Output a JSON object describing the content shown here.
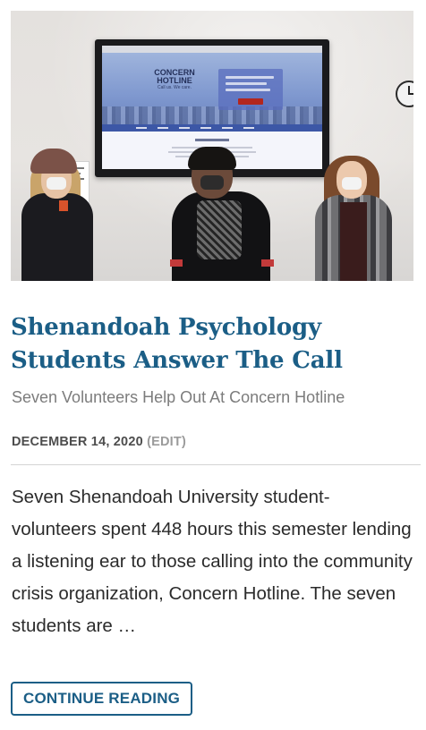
{
  "article": {
    "title": "Shenandoah Psychology Students Answer The Call",
    "subtitle": "Seven Volunteers Help Out At Concern Hotline",
    "date": "DECEMBER 14, 2020",
    "edit_label": "(EDIT)",
    "excerpt": "Seven Shenandoah University student-volunteers spent 448 hours this semester lending a listening ear to those calling into the community crisis organization, Concern Hotline. The seven students are …",
    "continue_label": "CONTINUE READING"
  },
  "photo": {
    "screen_logo": "CONCERN HOTLINE",
    "screen_tagline": "Call us. We care."
  },
  "colors": {
    "accent": "#1b5e86",
    "subtitle": "#7c7c7c",
    "meta_date": "#4d4d4d",
    "meta_edit": "#9b9b9b",
    "body_text": "#2b2b2b",
    "divider": "#d4d4d4"
  }
}
